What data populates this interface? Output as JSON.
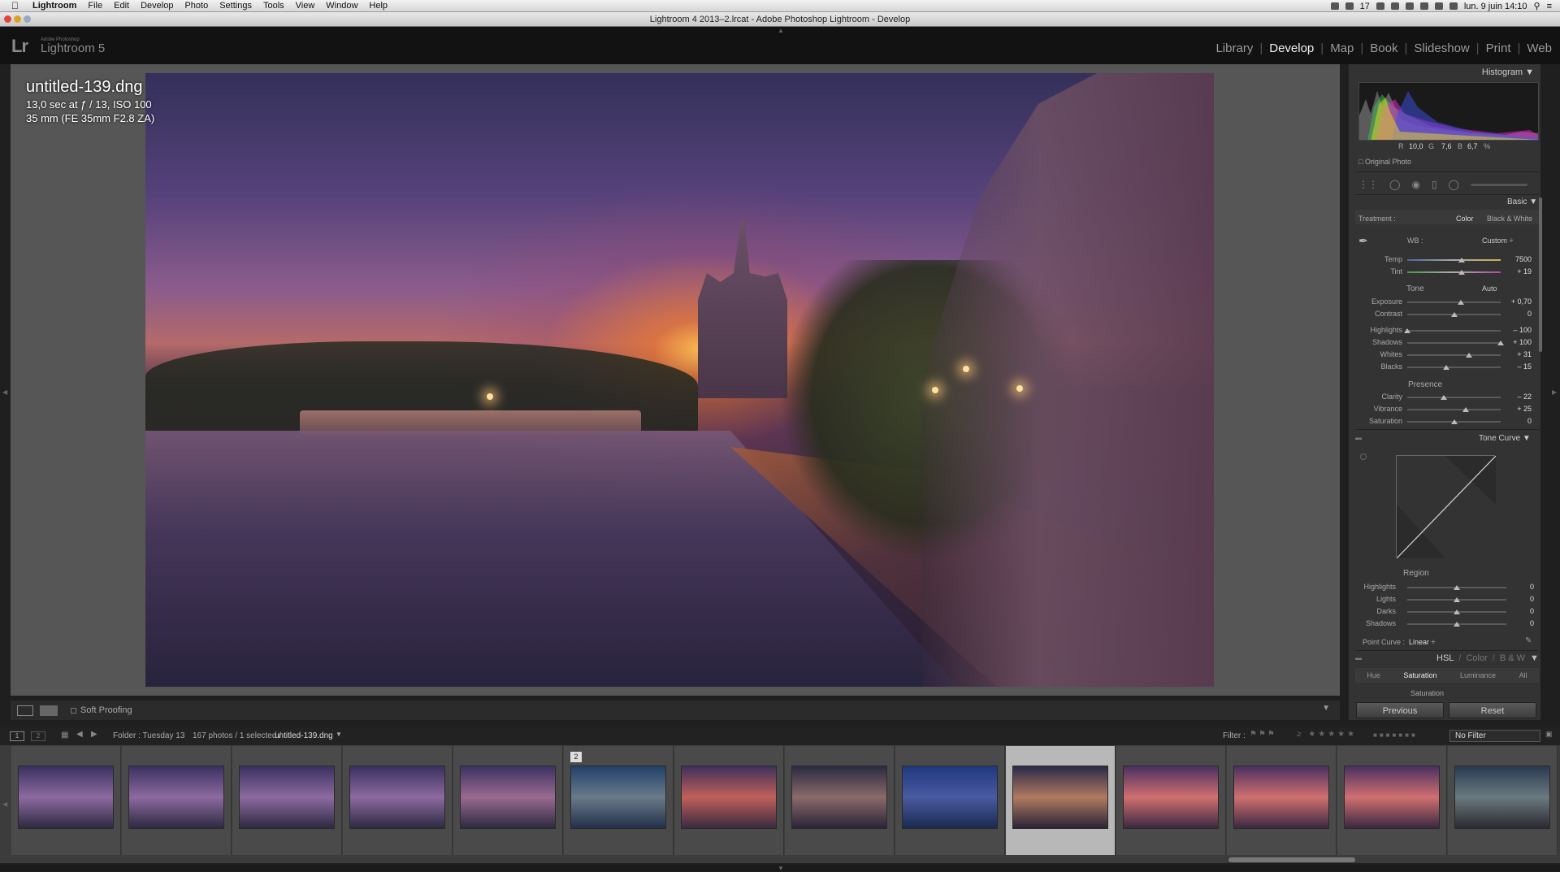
{
  "menubar": {
    "app": "Lightroom",
    "items": [
      "File",
      "Edit",
      "Develop",
      "Photo",
      "Settings",
      "Tools",
      "View",
      "Window",
      "Help"
    ],
    "battery": "17",
    "clock": "lun. 9 juin  14:10"
  },
  "window": {
    "title": "Lightroom 4 2013–2.lrcat - Adobe Photoshop Lightroom - Develop"
  },
  "identity": {
    "small": "Adobe Photoshop",
    "name": "Lightroom 5",
    "logo": "Lr"
  },
  "modules": {
    "library": "Library",
    "develop": "Develop",
    "map": "Map",
    "book": "Book",
    "slideshow": "Slideshow",
    "print": "Print",
    "web": "Web",
    "active": "Develop"
  },
  "photo_info": {
    "filename": "untitled-139.dng",
    "exposure": "13,0 sec at ƒ / 13, ISO 100",
    "lens": "35 mm (FE 35mm F2.8 ZA)"
  },
  "toolbar": {
    "soft_proofing": "Soft Proofing"
  },
  "right_panel": {
    "histogram": {
      "title": "Histogram",
      "r_label": "R",
      "r": "10,0",
      "g_label": "G",
      "g": "7,6",
      "b_label": "B",
      "b": "6,7",
      "pct": "%",
      "original_photo": "Original Photo"
    },
    "basic": {
      "title": "Basic",
      "treatment_label": "Treatment :",
      "treatment_color": "Color",
      "treatment_bw": "Black & White",
      "wb_label": "WB :",
      "wb_value": "Custom ÷",
      "temp": {
        "label": "Temp",
        "value": "7500",
        "level": 0.58
      },
      "tint": {
        "label": "Tint",
        "value": "+ 19",
        "level": 0.58
      },
      "tone_label": "Tone",
      "auto": "Auto",
      "exposure": {
        "label": "Exposure",
        "value": "+ 0,70",
        "level": 0.57
      },
      "contrast": {
        "label": "Contrast",
        "value": "0",
        "level": 0.5
      },
      "highlights": {
        "label": "Highlights",
        "value": "– 100",
        "level": 0.0
      },
      "shadows": {
        "label": "Shadows",
        "value": "+ 100",
        "level": 1.0
      },
      "whites": {
        "label": "Whites",
        "value": "+ 31",
        "level": 0.66
      },
      "blacks": {
        "label": "Blacks",
        "value": "– 15",
        "level": 0.42
      },
      "presence_label": "Presence",
      "clarity": {
        "label": "Clarity",
        "value": "– 22",
        "level": 0.39
      },
      "vibrance": {
        "label": "Vibrance",
        "value": "+ 25",
        "level": 0.63
      },
      "saturation": {
        "label": "Saturation",
        "value": "0",
        "level": 0.5
      }
    },
    "tone_curve": {
      "title": "Tone Curve",
      "region_label": "Region",
      "highlights": {
        "label": "Highlights",
        "value": "0",
        "level": 0.5
      },
      "lights": {
        "label": "Lights",
        "value": "0",
        "level": 0.5
      },
      "darks": {
        "label": "Darks",
        "value": "0",
        "level": 0.5
      },
      "shadows": {
        "label": "Shadows",
        "value": "0",
        "level": 0.5
      },
      "point_curve_label": "Point Curve :",
      "point_curve_value": "Linear ÷"
    },
    "hsl": {
      "title_hsl": "HSL",
      "sep": "/",
      "title_color": "Color",
      "title_bw": "B & W",
      "tabs": [
        "Hue",
        "Saturation",
        "Luminance",
        "All"
      ],
      "active_tab": "Saturation",
      "sub": "Saturation"
    },
    "previous": "Previous",
    "reset": "Reset"
  },
  "filmstrip_bar": {
    "screen1": "1",
    "screen2": "2",
    "folder": "Folder : Tuesday 13",
    "count": "167 photos / 1 selected /",
    "selected_file": "untitled-139.dng",
    "filter_label": "Filter :",
    "no_filter": "No Filter"
  },
  "filmstrip": {
    "selected_index": 9,
    "thumbs": [
      {
        "top": "#3a3060",
        "mid": "#8d6aa0",
        "bot": "#2c2a40"
      },
      {
        "top": "#3a3060",
        "mid": "#8d6aa0",
        "bot": "#2c2a40"
      },
      {
        "top": "#3a3060",
        "mid": "#8d6aa0",
        "bot": "#2c2a40"
      },
      {
        "top": "#3a3060",
        "mid": "#8d6aa0",
        "bot": "#2c2a40"
      },
      {
        "top": "#3c3262",
        "mid": "#9a6a90",
        "bot": "#2c2a40"
      },
      {
        "top": "#22406a",
        "mid": "#6a7a8a",
        "bot": "#23304a"
      },
      {
        "top": "#40305a",
        "mid": "#c0605a",
        "bot": "#3a2a40"
      },
      {
        "top": "#2a2a40",
        "mid": "#8a6a6a",
        "bot": "#2a2438"
      },
      {
        "top": "#203880",
        "mid": "#4a5aa0",
        "bot": "#1a2a50"
      },
      {
        "top": "#2a2a48",
        "mid": "#b07a60",
        "bot": "#2a2438"
      },
      {
        "top": "#4a3060",
        "mid": "#d07070",
        "bot": "#3a2840"
      },
      {
        "top": "#4a3060",
        "mid": "#d07070",
        "bot": "#3a2840"
      },
      {
        "top": "#4a3060",
        "mid": "#d07070",
        "bot": "#3a2840"
      },
      {
        "top": "#2a3a50",
        "mid": "#6a7a80",
        "bot": "#2a2a30"
      }
    ],
    "badge": "2"
  }
}
